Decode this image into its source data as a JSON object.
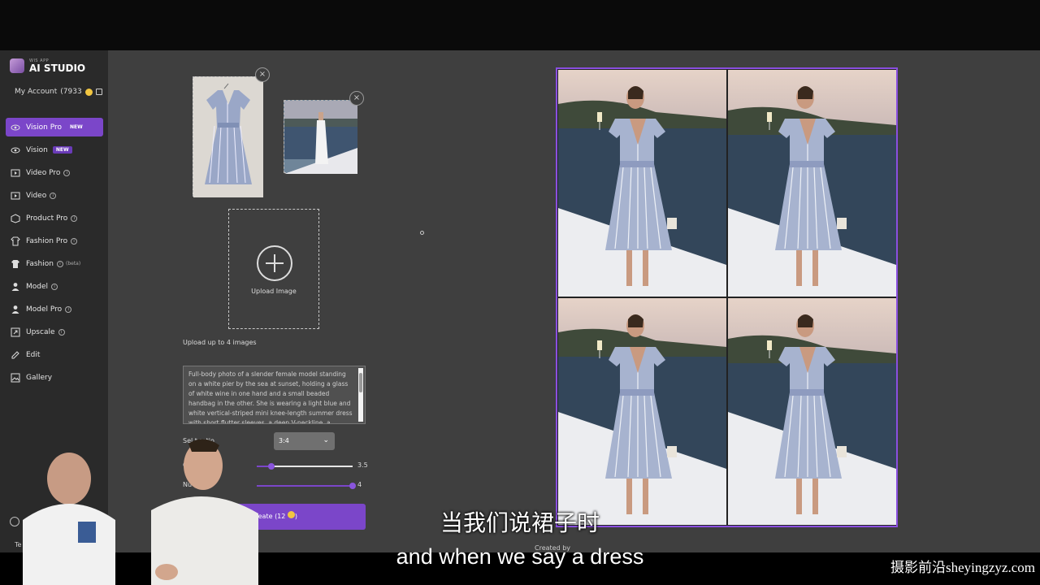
{
  "app": {
    "brand_small": "WIS APP",
    "brand": "AI STUDIO",
    "account_label": "My Account",
    "credits": "(7933"
  },
  "nav": [
    {
      "label": "Vision Pro",
      "icon": "eye-sparkle-icon",
      "badge": "NEW",
      "active": true
    },
    {
      "label": "Vision",
      "icon": "eye-sparkle-icon",
      "badge": "NEW"
    },
    {
      "label": "Video Pro",
      "icon": "video-icon",
      "info": true
    },
    {
      "label": "Video",
      "icon": "video-icon",
      "info": true
    },
    {
      "label": "Product Pro",
      "icon": "box-icon",
      "info": true
    },
    {
      "label": "Fashion Pro",
      "icon": "shirt-icon",
      "info": true
    },
    {
      "label": "Fashion",
      "icon": "shirt-filled-icon",
      "info": true,
      "beta": "(beta)"
    },
    {
      "label": "Model",
      "icon": "person-icon",
      "info": true
    },
    {
      "label": "Model Pro",
      "icon": "person-icon",
      "info": true
    },
    {
      "label": "Upscale",
      "icon": "upscale-icon",
      "info": true
    },
    {
      "label": "Edit",
      "icon": "edit-icon"
    },
    {
      "label": "Gallery",
      "icon": "gallery-icon"
    }
  ],
  "sidebar_footer": {
    "text": "Te"
  },
  "form": {
    "upload_label": "Upload Image",
    "upload_hint": "Upload up to 4 images",
    "prompt": "Full-body photo of a slender female model standing on a white pier by the sea at sunset, holding a glass of white wine in one hand and a small beaded handbag in the other. She is wearing a light blue and white vertical-striped mini knee-length summer dress with short flutter sleeves, a deep V-neckline, a smocked waist, and",
    "ratio_label": "Sel          t ratio",
    "ratio_value": "3:4",
    "guidance_label": "C",
    "guidance_value": "3.5",
    "guidance_fraction": 0.15,
    "num_label": "Nu          ges",
    "num_value": "4",
    "num_fraction": 1.0,
    "create_label": "Create (12"
  },
  "footer": {
    "created_by": "Created by"
  },
  "subtitles": {
    "cn": "当我们说裙子时",
    "en": "and when we say a dress"
  },
  "watermark": "摄影前沿sheyingzyz.com",
  "colors": {
    "accent": "#7b46c9",
    "panel": "#3f3f3f",
    "sidebar": "#2a2a2a"
  }
}
